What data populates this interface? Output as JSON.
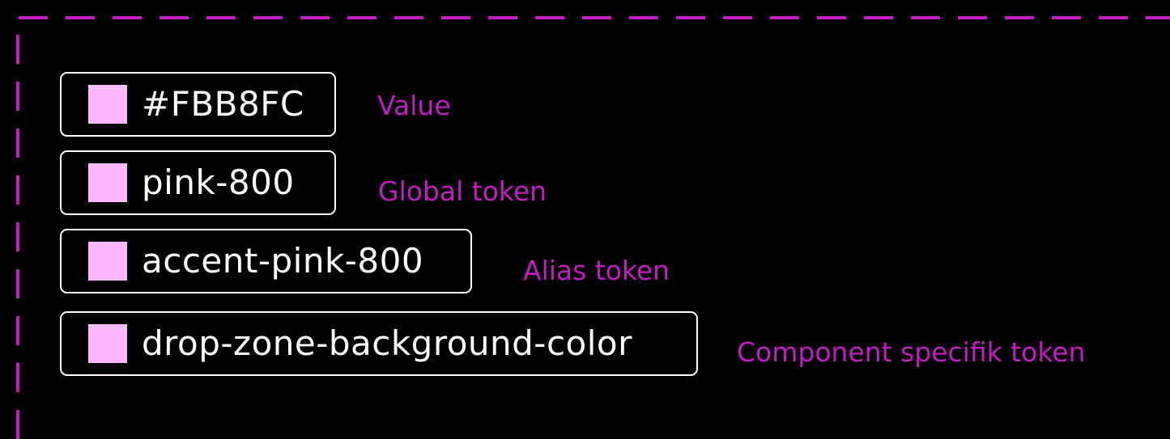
{
  "colors": {
    "background": "#000000",
    "frame_dash": "#C41BC4",
    "caption": "#C41BC4",
    "chip_border": "#FFFFFF",
    "chip_text": "#FFFFFF",
    "swatch": "#FBB8FC"
  },
  "tokens": [
    {
      "label": "#FBB8FC",
      "caption": "Value"
    },
    {
      "label": "pink-800",
      "caption": "Global token"
    },
    {
      "label": "accent-pink-800",
      "caption": "Alias token"
    },
    {
      "label": "drop-zone-background-color",
      "caption": "Component specifik token"
    }
  ]
}
